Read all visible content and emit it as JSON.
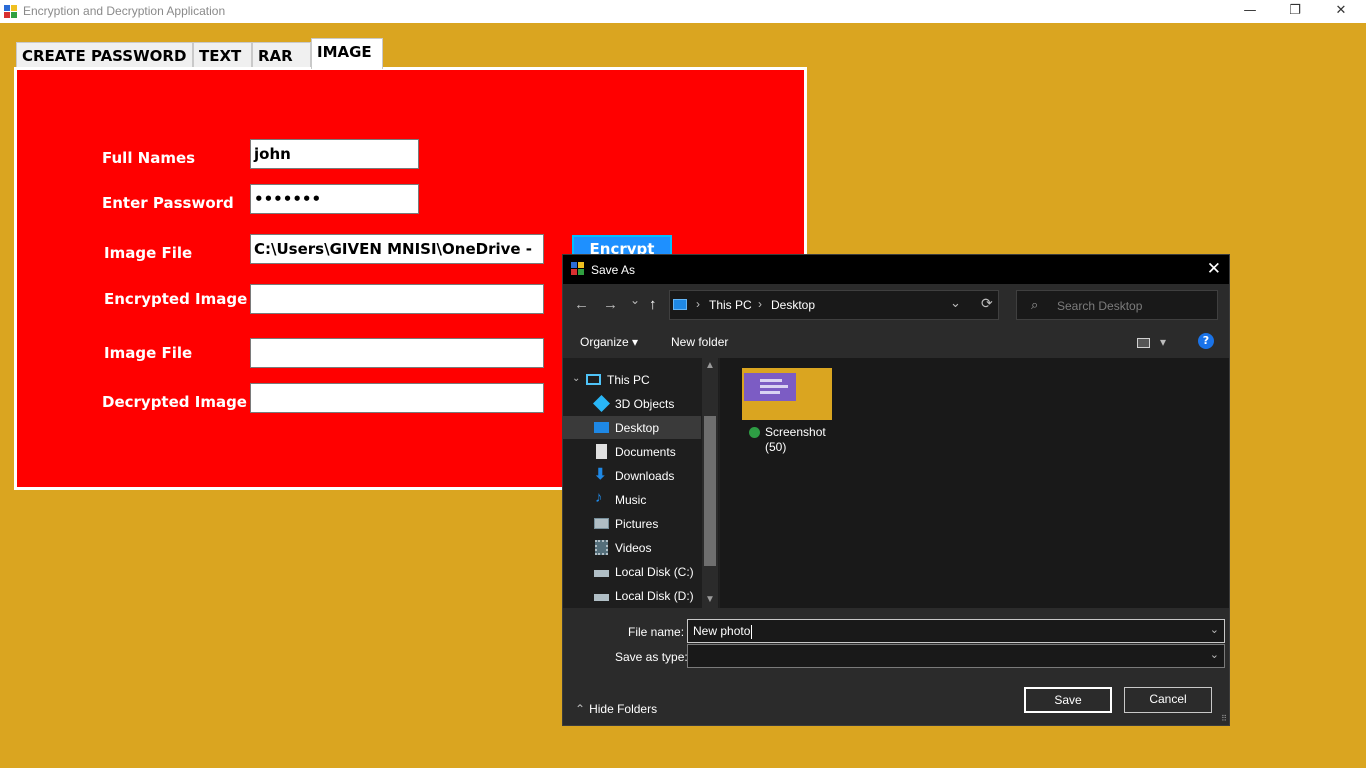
{
  "app": {
    "title": "Encryption and Decryption Application",
    "controls": {
      "minimize": "—",
      "maximize": "❐",
      "close": "✕"
    }
  },
  "tabs": [
    {
      "label": "CREATE PASSWORD"
    },
    {
      "label": "TEXT"
    },
    {
      "label": "RAR"
    },
    {
      "label": "IMAGE",
      "active": true
    }
  ],
  "form": {
    "full_names_label": "Full Names",
    "full_names_value": "john",
    "password_label": "Enter Password",
    "password_value": "•••••••",
    "image_file_label": "Image File",
    "image_file_value": "C:\\Users\\GIVEN MNISI\\OneDrive - ",
    "encrypted_image_label": "Encrypted Image",
    "encrypted_image_value": "",
    "image_file2_label": "Image File",
    "image_file2_value": "",
    "decrypted_image_label": "Decrypted Image",
    "decrypted_image_value": "",
    "encrypt_button": "Encrypt"
  },
  "dialog": {
    "title": "Save As",
    "close_glyph": "✕",
    "nav": {
      "back": "←",
      "forward": "→",
      "history": "⌄",
      "up": "↑",
      "dropdown": "⌄",
      "refresh": "⟳"
    },
    "breadcrumb": [
      "This PC",
      "Desktop"
    ],
    "breadcrumb_sep": "›",
    "search_placeholder": "Search Desktop",
    "toolbar": {
      "organize": "Organize ▾",
      "new_folder": "New folder",
      "help": "?",
      "view_dropdown": "▾"
    },
    "nav_pane": [
      {
        "label": "This PC",
        "icon": "monitor-icon",
        "color": "#4fc3f7"
      },
      {
        "label": "3D Objects",
        "icon": "cube-icon",
        "color": "#4fc3f7"
      },
      {
        "label": "Desktop",
        "icon": "desktop-icon",
        "color": "#1e88e5",
        "selected": true
      },
      {
        "label": "Documents",
        "icon": "document-icon",
        "color": "#e0e0e0"
      },
      {
        "label": "Downloads",
        "icon": "download-icon",
        "color": "#1e88e5"
      },
      {
        "label": "Music",
        "icon": "music-icon",
        "color": "#1e88e5"
      },
      {
        "label": "Pictures",
        "icon": "pictures-icon",
        "color": "#b0bec5"
      },
      {
        "label": "Videos",
        "icon": "videos-icon",
        "color": "#b0bec5"
      },
      {
        "label": "Local Disk (C:)",
        "icon": "drive-icon",
        "color": "#b0bec5"
      },
      {
        "label": "Local Disk (D:)",
        "icon": "drive-icon",
        "color": "#b0bec5"
      }
    ],
    "files": [
      {
        "name_line1": "Screenshot",
        "name_line2": "(50)"
      }
    ],
    "file_name_label": "File name:",
    "file_name_value": "New photo",
    "save_as_type_label": "Save as type:",
    "save_as_type_value": "",
    "save_button": "Save",
    "cancel_button": "Cancel",
    "hide_folders": "Hide Folders"
  }
}
